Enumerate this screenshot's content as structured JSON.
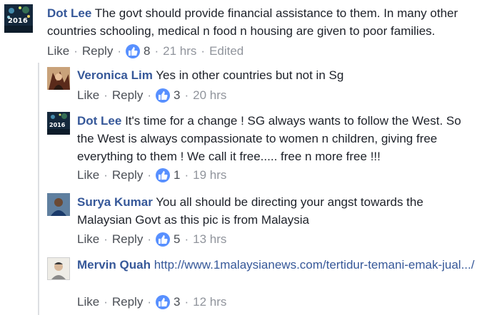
{
  "comments": [
    {
      "author": "Dot Lee",
      "text": "The govt should provide financial assistance to them. In many other countries schooling, medical n food n housing are given to poor families.",
      "like_label": "Like",
      "reply_label": "Reply",
      "likes": "8",
      "time": "21 hrs",
      "edited": "Edited",
      "avatar_text": "2016"
    },
    {
      "author": "Veronica Lim",
      "text": "Yes in other countries but not in Sg",
      "like_label": "Like",
      "reply_label": "Reply",
      "likes": "3",
      "time": "20 hrs"
    },
    {
      "author": "Dot Lee",
      "text": "It's time for a change ! SG always wants to follow the West. So the West is always compassionate to women n children, giving free everything to them ! We call it free..... free n more free !!!",
      "like_label": "Like",
      "reply_label": "Reply",
      "likes": "1",
      "time": "19 hrs",
      "avatar_text": "2016"
    },
    {
      "author": "Surya Kumar",
      "text": "You all should be directing your angst towards the Malaysian Govt as this pic is from Malaysia",
      "like_label": "Like",
      "reply_label": "Reply",
      "likes": "5",
      "time": "13 hrs"
    },
    {
      "author": "Mervin Quah",
      "text": "http://www.1malaysianews.com/tertidur-temani-emak-jual.../",
      "like_label": "Like",
      "reply_label": "Reply",
      "likes": "3",
      "time": "12 hrs"
    }
  ],
  "colors": {
    "author": "#365899",
    "like_badge": "#5890ff",
    "meta": "#90949c"
  }
}
